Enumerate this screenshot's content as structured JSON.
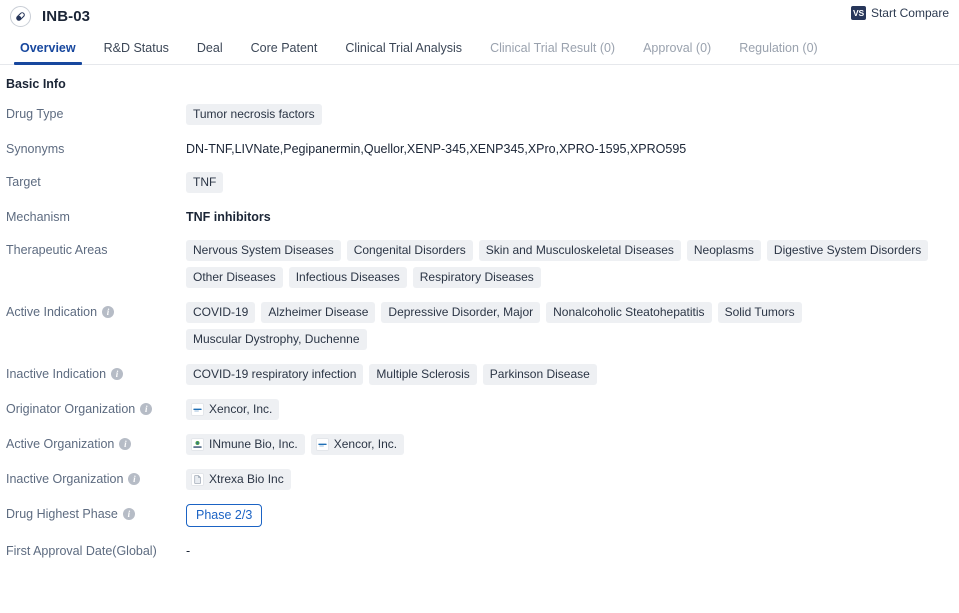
{
  "header": {
    "drug_icon": "pill-capsule-icon",
    "title": "INB-03",
    "compare": {
      "badge": "VS",
      "label": "Start Compare"
    }
  },
  "tabs": [
    {
      "label": "Overview",
      "active": true,
      "disabled": false
    },
    {
      "label": "R&D Status",
      "active": false,
      "disabled": false
    },
    {
      "label": "Deal",
      "active": false,
      "disabled": false
    },
    {
      "label": "Core Patent",
      "active": false,
      "disabled": false
    },
    {
      "label": "Clinical Trial Analysis",
      "active": false,
      "disabled": false
    },
    {
      "label": "Clinical Trial Result (0)",
      "active": false,
      "disabled": true
    },
    {
      "label": "Approval (0)",
      "active": false,
      "disabled": true
    },
    {
      "label": "Regulation (0)",
      "active": false,
      "disabled": true
    }
  ],
  "section": {
    "title": "Basic Info"
  },
  "rows": {
    "drug_type": {
      "label": "Drug Type",
      "tags": [
        "Tumor necrosis factors"
      ]
    },
    "synonyms": {
      "label": "Synonyms",
      "text": "DN-TNF,LIVNate,Pegipanermin,Quellor,XENP-345,XENP345,XPro,XPRO-1595,XPRO595"
    },
    "target": {
      "label": "Target",
      "tags": [
        "TNF"
      ]
    },
    "mechanism": {
      "label": "Mechanism",
      "text": "TNF inhibitors"
    },
    "therapeutic_areas": {
      "label": "Therapeutic Areas",
      "tags": [
        "Nervous System Diseases",
        "Congenital Disorders",
        "Skin and Musculoskeletal Diseases",
        "Neoplasms",
        "Digestive System Disorders",
        "Other Diseases",
        "Infectious Diseases",
        "Respiratory Diseases"
      ]
    },
    "active_indication": {
      "label": "Active Indication",
      "info": true,
      "tags": [
        "COVID-19",
        "Alzheimer Disease",
        "Depressive Disorder, Major",
        "Nonalcoholic Steatohepatitis",
        "Solid Tumors",
        "Muscular Dystrophy, Duchenne"
      ]
    },
    "inactive_indication": {
      "label": "Inactive Indication",
      "info": true,
      "tags": [
        "COVID-19 respiratory infection",
        "Multiple Sclerosis",
        "Parkinson Disease"
      ]
    },
    "originator_organization": {
      "label": "Originator Organization",
      "info": true,
      "orgs": [
        {
          "name": "Xencor, Inc.",
          "logo": "xencor-logo"
        }
      ]
    },
    "active_organization": {
      "label": "Active Organization",
      "info": true,
      "orgs": [
        {
          "name": "INmune Bio, Inc.",
          "logo": "inmune-bio-logo"
        },
        {
          "name": "Xencor, Inc.",
          "logo": "xencor-logo"
        }
      ]
    },
    "inactive_organization": {
      "label": "Inactive Organization",
      "info": true,
      "orgs": [
        {
          "name": "Xtrexa Bio Inc",
          "logo": "xtrexa-bio-logo"
        }
      ]
    },
    "drug_highest_phase": {
      "label": "Drug Highest Phase",
      "info": true,
      "badge": "Phase 2/3"
    },
    "first_approval_date": {
      "label": "First Approval Date(Global)",
      "text": "-"
    }
  },
  "colors": {
    "accent": "#17479e",
    "phase_badge": "#1b63c4",
    "tag_bg": "#eef0f3",
    "label_text": "#5d6b80",
    "vs_badge_bg": "#27365a"
  }
}
